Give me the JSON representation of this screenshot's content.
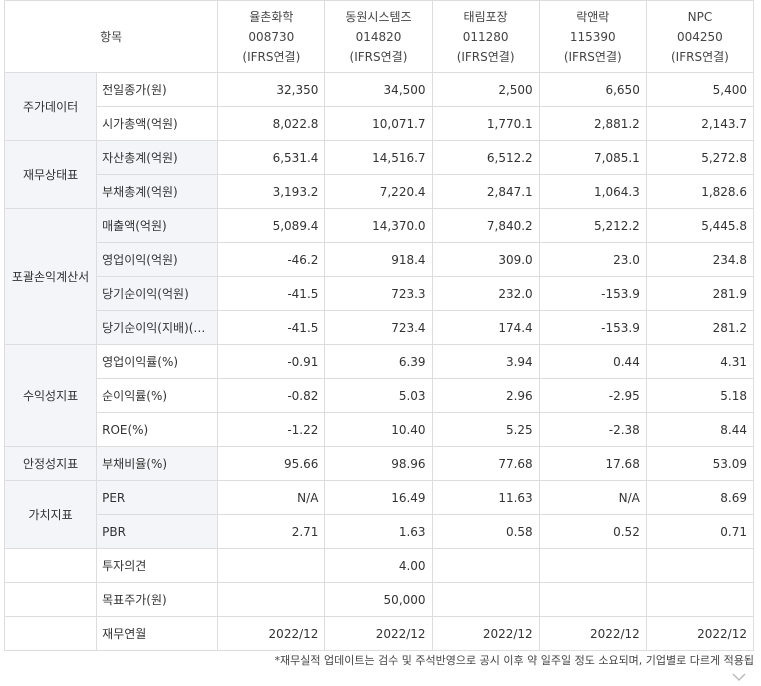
{
  "header": {
    "item_label": "항목",
    "companies": [
      {
        "name": "율촌화학",
        "code": "008730",
        "basis": "(IFRS연결)"
      },
      {
        "name": "동원시스템즈",
        "code": "014820",
        "basis": "(IFRS연결)"
      },
      {
        "name": "태림포장",
        "code": "011280",
        "basis": "(IFRS연결)"
      },
      {
        "name": "락앤락",
        "code": "115390",
        "basis": "(IFRS연결)"
      },
      {
        "name": "NPC",
        "code": "004250",
        "basis": "(IFRS연결)"
      }
    ]
  },
  "groups": [
    {
      "name": "주가데이터",
      "rows": [
        {
          "label": "전일종가(원)",
          "values": [
            "32,350",
            "34,500",
            "2,500",
            "6,650",
            "5,400"
          ]
        },
        {
          "label": "시가총액(억원)",
          "values": [
            "8,022.8",
            "10,071.7",
            "1,770.1",
            "2,881.2",
            "2,143.7"
          ]
        }
      ]
    },
    {
      "name": "재무상태표",
      "rows": [
        {
          "label": "자산총계(억원)",
          "values": [
            "6,531.4",
            "14,516.7",
            "6,512.2",
            "7,085.1",
            "5,272.8"
          ]
        },
        {
          "label": "부채총계(억원)",
          "values": [
            "3,193.2",
            "7,220.4",
            "2,847.1",
            "1,064.3",
            "1,828.6"
          ]
        }
      ]
    },
    {
      "name": "포괄손익계산서",
      "rows": [
        {
          "label": "매출액(억원)",
          "values": [
            "5,089.4",
            "14,370.0",
            "7,840.2",
            "5,212.2",
            "5,445.8"
          ]
        },
        {
          "label": "영업이익(억원)",
          "values": [
            "-46.2",
            "918.4",
            "309.0",
            "23.0",
            "234.8"
          ]
        },
        {
          "label": "당기순이익(억원)",
          "values": [
            "-41.5",
            "723.3",
            "232.0",
            "-153.9",
            "281.9"
          ]
        },
        {
          "label": "당기순이익(지배)(…",
          "values": [
            "-41.5",
            "723.4",
            "174.4",
            "-153.9",
            "281.2"
          ]
        }
      ]
    },
    {
      "name": "수익성지표",
      "rows": [
        {
          "label": "영업이익률(%)",
          "values": [
            "-0.91",
            "6.39",
            "3.94",
            "0.44",
            "4.31"
          ]
        },
        {
          "label": "순이익률(%)",
          "values": [
            "-0.82",
            "5.03",
            "2.96",
            "-2.95",
            "5.18"
          ]
        },
        {
          "label": "ROE(%)",
          "values": [
            "-1.22",
            "10.40",
            "5.25",
            "-2.38",
            "8.44"
          ]
        }
      ]
    },
    {
      "name": "안정성지표",
      "rows": [
        {
          "label": "부채비율(%)",
          "values": [
            "95.66",
            "98.96",
            "77.68",
            "17.68",
            "53.09"
          ]
        }
      ]
    },
    {
      "name": "가치지표",
      "rows": [
        {
          "label": "PER",
          "values": [
            "N/A",
            "16.49",
            "11.63",
            "N/A",
            "8.69"
          ]
        },
        {
          "label": "PBR",
          "values": [
            "2.71",
            "1.63",
            "0.58",
            "0.52",
            "0.71"
          ]
        }
      ]
    }
  ],
  "bottom_rows": [
    {
      "label": "투자의견",
      "values": [
        "",
        "4.00",
        "",
        "",
        ""
      ]
    },
    {
      "label": "목표주가(원)",
      "values": [
        "",
        "50,000",
        "",
        "",
        ""
      ]
    },
    {
      "label": "재무연월",
      "values": [
        "2022/12",
        "2022/12",
        "2022/12",
        "2022/12",
        "2022/12"
      ]
    }
  ],
  "footnote": "*재무실적 업데이트는 검수 및 주석반영으로 공시 이후 약 일주일 정도 소요되며, 기업별로 다르게 적용됩",
  "icons": {
    "scroll": "chevron-down-icon"
  }
}
